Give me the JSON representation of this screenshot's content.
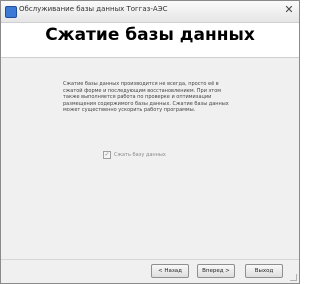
{
  "window": {
    "title": "Обслуживание базы данных Тоггаз-АЭС",
    "close_symbol": "✕"
  },
  "header": {
    "title": "Сжатие базы данных"
  },
  "main": {
    "description": "Сжатие базы данных производится не всегда, просто её в сжатой форме и последующим восстановлением. При этом также выполняется работа по проверке и оптимизации размещения содержимого базы данных. Сжатие базы данных может существенно ускорить работу программы.",
    "compress_checkbox": {
      "label": "Сжать базу данных",
      "checked": true,
      "enabled": false
    }
  },
  "footer": {
    "back_label": "< Назад",
    "next_label": "Вперед >",
    "exit_label": "Выход"
  },
  "icons": {
    "app": "app-icon",
    "close": "close-icon",
    "check": "check-icon"
  }
}
